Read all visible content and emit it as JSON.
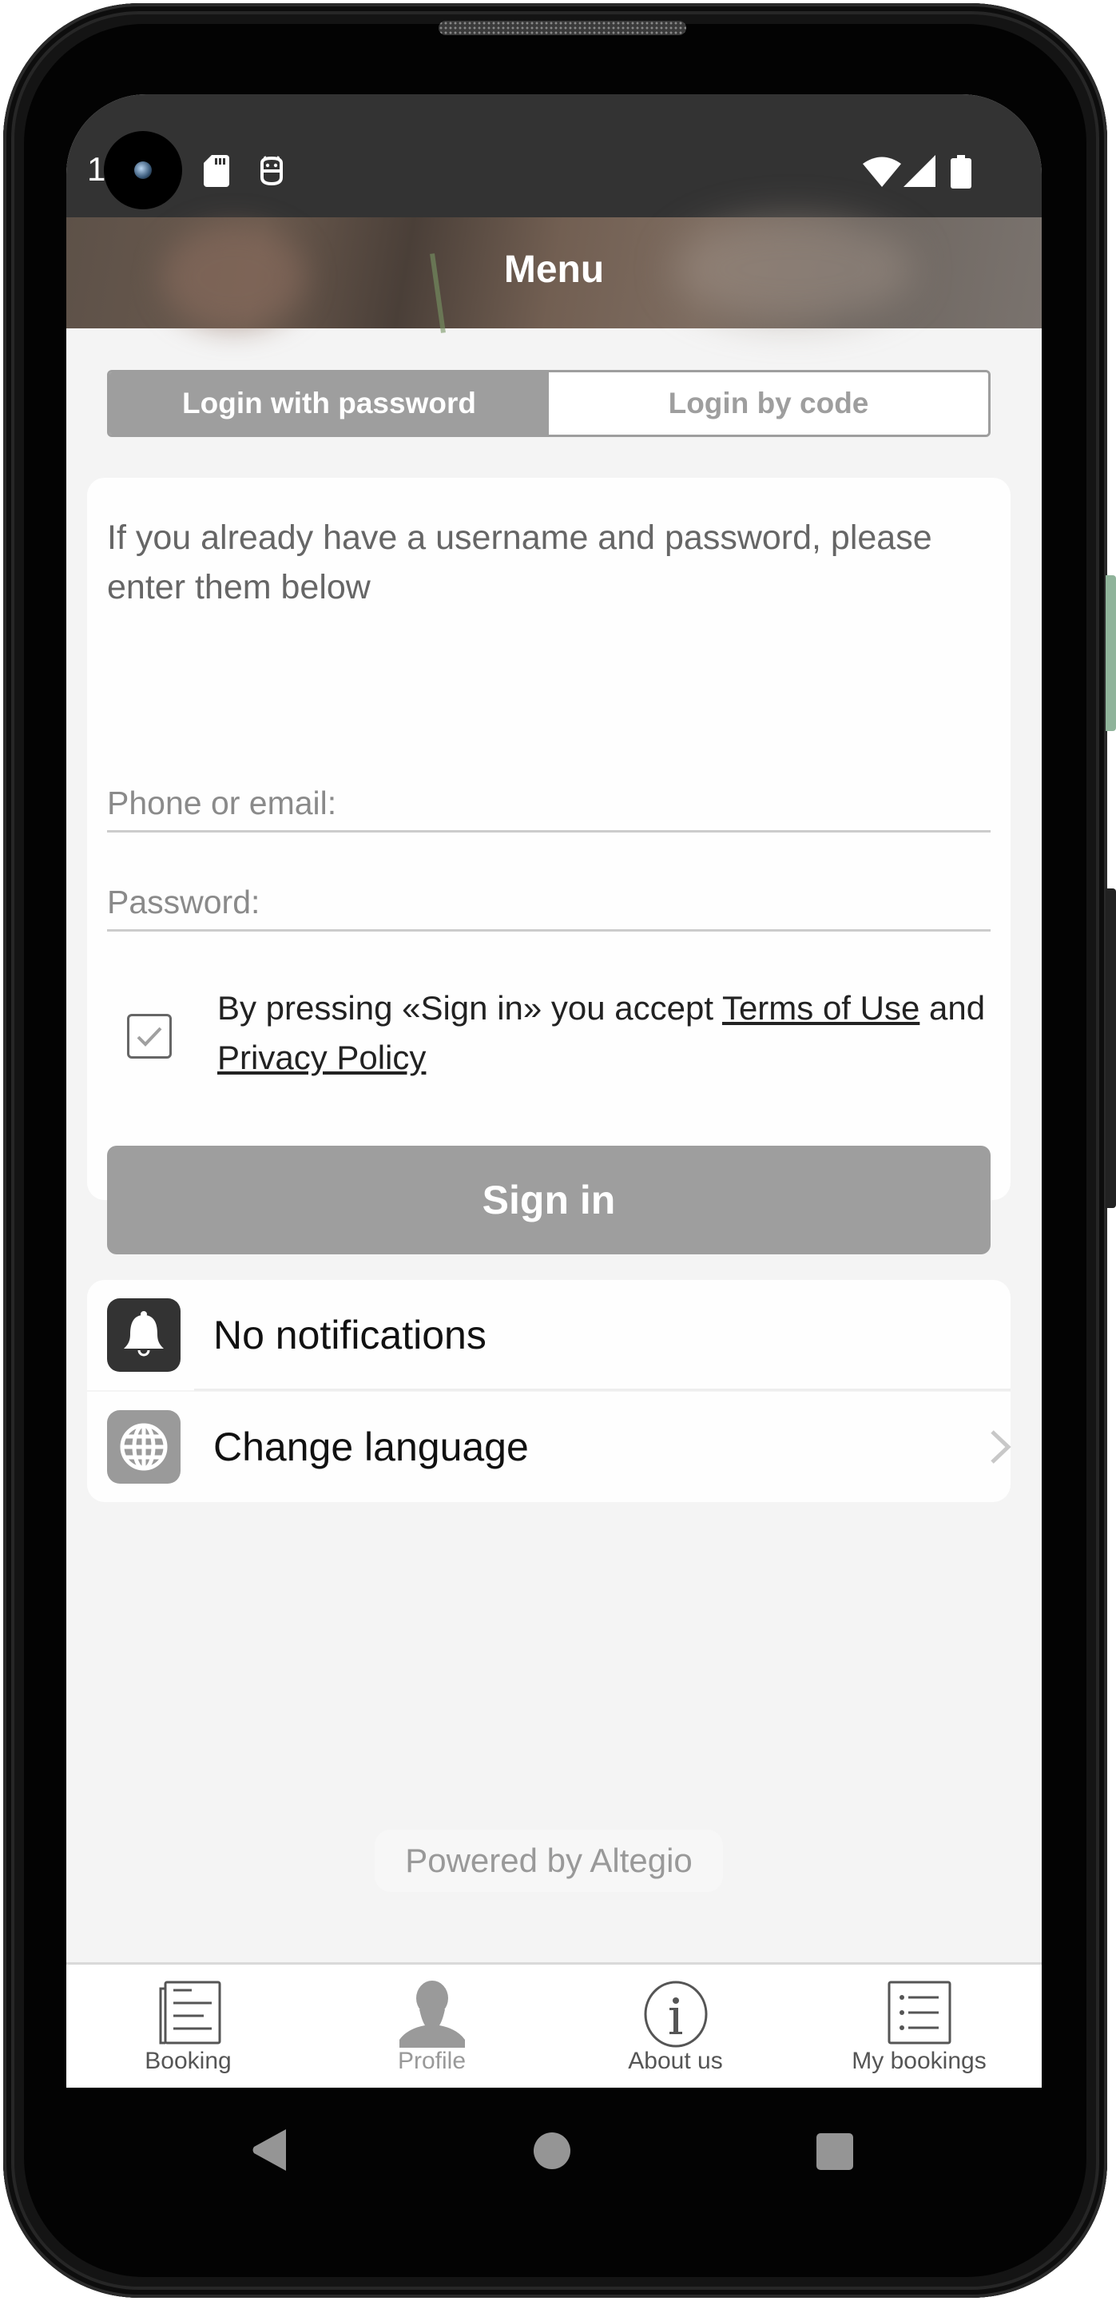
{
  "status_bar": {
    "time": "1",
    "icons": [
      "sd-card-icon",
      "debug-icon",
      "wifi-icon",
      "signal-icon",
      "battery-icon"
    ]
  },
  "header": {
    "title": "Menu"
  },
  "login_tabs": [
    {
      "label": "Login with password",
      "active": true
    },
    {
      "label": "Login by code",
      "active": false
    }
  ],
  "login_form": {
    "intro": "If you already have a username and password, please enter them below",
    "phone_placeholder": "Phone or email:",
    "phone_value": "",
    "password_placeholder": "Password:",
    "password_value": "",
    "consent_checked": true,
    "consent_prefix": "By pressing «Sign in» you accept ",
    "terms_link": "Terms of Use",
    "consent_and": " and ",
    "privacy_link": "Privacy Policy",
    "signin_label": "Sign in"
  },
  "menu_items": [
    {
      "label": "No notifications",
      "icon": "bell-icon"
    },
    {
      "label": "Change language",
      "icon": "globe-icon",
      "chevron": true
    }
  ],
  "footer": {
    "powered_by": "Powered by Altegio"
  },
  "tabbar": {
    "items": [
      {
        "label": "Booking",
        "icon": "booking-document-icon",
        "active": false
      },
      {
        "label": "Profile",
        "icon": "person-icon",
        "active": true
      },
      {
        "label": "About us",
        "icon": "info-icon",
        "active": false
      },
      {
        "label": "My bookings",
        "icon": "list-icon",
        "active": false
      }
    ]
  },
  "colors": {
    "accent_gray": "#9e9e9e",
    "background": "#f4f4f4",
    "card": "#fefefe",
    "status_bar": "#333333",
    "text_primary": "#111111",
    "text_muted": "#999999"
  }
}
